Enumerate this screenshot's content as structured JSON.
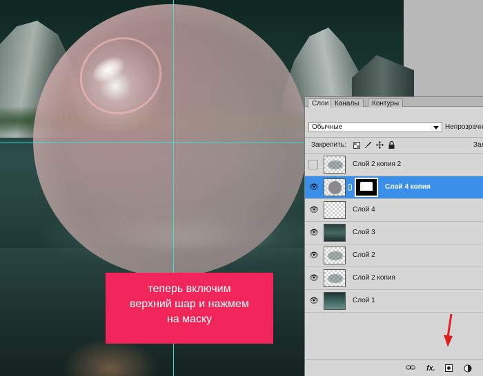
{
  "callout": {
    "lines": [
      "теперь включим",
      "верхний шар  и нажмем",
      "на маску"
    ],
    "color": "#f0265a"
  },
  "panel": {
    "tabs": [
      "Слои",
      "Каналы",
      "Контуры"
    ],
    "active_tab": "Слои",
    "blend_mode": "Обычные",
    "opacity_label": "Непрозрачность",
    "lock_label": "Закрепить:",
    "fill_label": "Заливка",
    "lock_icons": [
      "lock-transparency-icon",
      "brush-icon",
      "move-icon",
      "lock-icon"
    ],
    "layers": [
      {
        "name": "Слой 2 копия 2",
        "visible": false,
        "thumb": "cloud"
      },
      {
        "name": "Слой 4 копия",
        "visible": true,
        "thumb": "ball",
        "has_mask": true,
        "selected": true
      },
      {
        "name": "Слой 4",
        "visible": true,
        "thumb": "empty"
      },
      {
        "name": "Слой 3",
        "visible": true,
        "thumb": "scene"
      },
      {
        "name": "Слой 2",
        "visible": true,
        "thumb": "cloud"
      },
      {
        "name": "Слой 2 копия",
        "visible": true,
        "thumb": "cloud"
      },
      {
        "name": "Слой 1",
        "visible": true,
        "thumb": "gradient"
      }
    ],
    "bottom_icons": [
      "link-layers-icon",
      "fx-icon",
      "add-mask-icon",
      "adjustment-icon"
    ],
    "fx_label": "fx.",
    "selection_color": "#3a8fe8"
  },
  "guides_color": "#38e0e0"
}
